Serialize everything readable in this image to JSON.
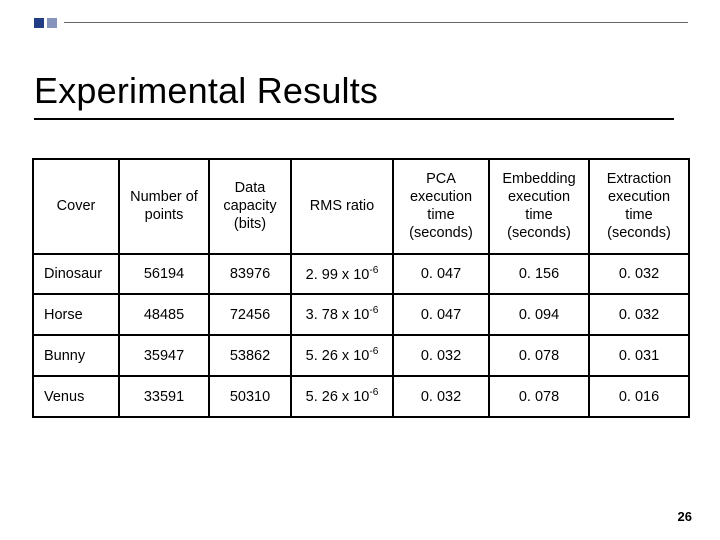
{
  "title": "Experimental Results",
  "chart_data": {
    "type": "table",
    "headers": [
      "Cover",
      "Number of points",
      "Data capacity (bits)",
      "RMS ratio",
      "PCA execution time (seconds)",
      "Embedding execution time (seconds)",
      "Extraction execution time (seconds)"
    ],
    "rows": [
      {
        "cover": "Dinosaur",
        "points": "56194",
        "capacity": "83976",
        "rms_coeff": "2. 99",
        "rms_exp": "-6",
        "pca": "0. 047",
        "embed": "0. 156",
        "extract": "0. 032"
      },
      {
        "cover": "Horse",
        "points": "48485",
        "capacity": "72456",
        "rms_coeff": "3. 78",
        "rms_exp": "-6",
        "pca": "0. 047",
        "embed": "0. 094",
        "extract": "0. 032"
      },
      {
        "cover": "Bunny",
        "points": "35947",
        "capacity": "53862",
        "rms_coeff": "5. 26",
        "rms_exp": "-6",
        "pca": "0. 032",
        "embed": "0. 078",
        "extract": "0. 031"
      },
      {
        "cover": "Venus",
        "points": "33591",
        "capacity": "50310",
        "rms_coeff": "5. 26",
        "rms_exp": "-6",
        "pca": "0. 032",
        "embed": "0. 078",
        "extract": "0. 016"
      }
    ]
  },
  "page_number": "26"
}
